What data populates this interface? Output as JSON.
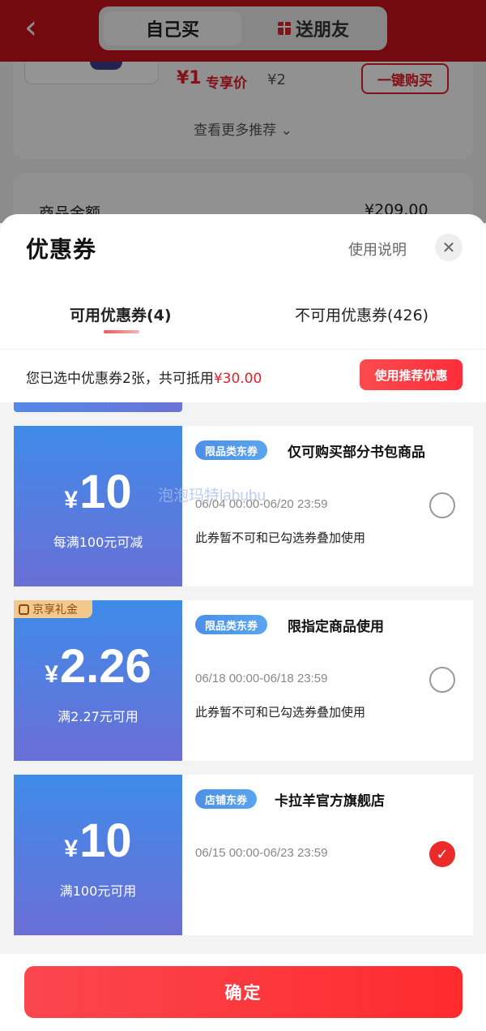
{
  "header": {
    "back_icon": "back-chevron-icon",
    "segment_self": "自己买",
    "segment_gift": "送朋友",
    "gift_icon": "gift-icon"
  },
  "background": {
    "price": "¥1",
    "price_tag": "专享价",
    "price_original": "¥2",
    "buy_button": "一键购买",
    "more_recommend": "查看更多推荐",
    "row_label": "商品金额",
    "row_value": "¥209.00"
  },
  "sheet": {
    "title": "优惠券",
    "usage_link": "使用说明",
    "close_icon": "close-icon",
    "tabs": [
      {
        "label": "可用优惠券(4)",
        "active": true
      },
      {
        "label": "不可用优惠券(426)",
        "active": false
      }
    ],
    "selected_prefix": "您已选中优惠券2张，共可抵用",
    "selected_amount": "¥30.00",
    "recommend_button": "使用推荐优惠",
    "confirm_button": "确定"
  },
  "coupons": [
    {
      "currency": "¥",
      "amount": "10",
      "condition": "每满100元可减",
      "badge": "限品类东券",
      "title": "仅可购买部分书包商品",
      "validity": "06/04 00:00-06/20 23:59",
      "note": "此券暂不可和已勾选券叠加使用",
      "checked": false
    },
    {
      "tag": "京享礼金",
      "currency": "¥",
      "amount": "2.26",
      "condition": "满2.27元可用",
      "badge": "限品类东券",
      "title": "限指定商品使用",
      "validity": "06/18 00:00-06/18 23:59",
      "note": "此券暂不可和已勾选券叠加使用",
      "checked": false
    },
    {
      "currency": "¥",
      "amount": "10",
      "condition": "满100元可用",
      "badge": "店铺东券",
      "title": "卡拉羊官方旗舰店",
      "validity": "06/15 00:00-06/23 23:59",
      "checked": true
    }
  ],
  "watermark": "泡泡玛特labubu",
  "colors": {
    "brand_red": "#e0202a",
    "coupon_blue": "#4c8fe8",
    "coupon_purple": "#6a6fd6"
  }
}
